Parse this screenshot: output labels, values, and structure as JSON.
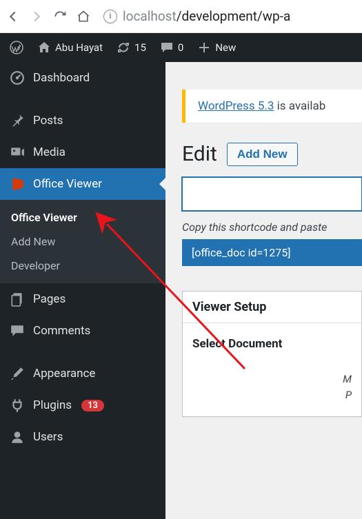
{
  "browser": {
    "url_host": "localhost",
    "url_path": "/development/wp-a"
  },
  "adminbar": {
    "site_name": "Abu Hayat",
    "updates_count": "15",
    "comments_count": "0",
    "new_label": "New"
  },
  "sidebar": {
    "items": [
      {
        "label": "Dashboard"
      },
      {
        "label": "Posts"
      },
      {
        "label": "Media"
      },
      {
        "label": "Office Viewer"
      },
      {
        "label": "Pages"
      },
      {
        "label": "Comments"
      },
      {
        "label": "Appearance"
      },
      {
        "label": "Plugins",
        "badge": "13"
      },
      {
        "label": "Users"
      }
    ],
    "submenu": [
      {
        "label": "Office Viewer"
      },
      {
        "label": "Add New"
      },
      {
        "label": "Developer"
      }
    ]
  },
  "content": {
    "update_link": "WordPress 5.3",
    "update_text": " is availab",
    "heading": "Edit",
    "add_new": "Add New",
    "title_value": "",
    "hint": "Copy this shortcode and paste",
    "shortcode": "[office_doc id=1275]",
    "postbox_title": "Viewer Setup",
    "field_label": "Select Document",
    "note_line1": "M",
    "note_line2": "P"
  }
}
